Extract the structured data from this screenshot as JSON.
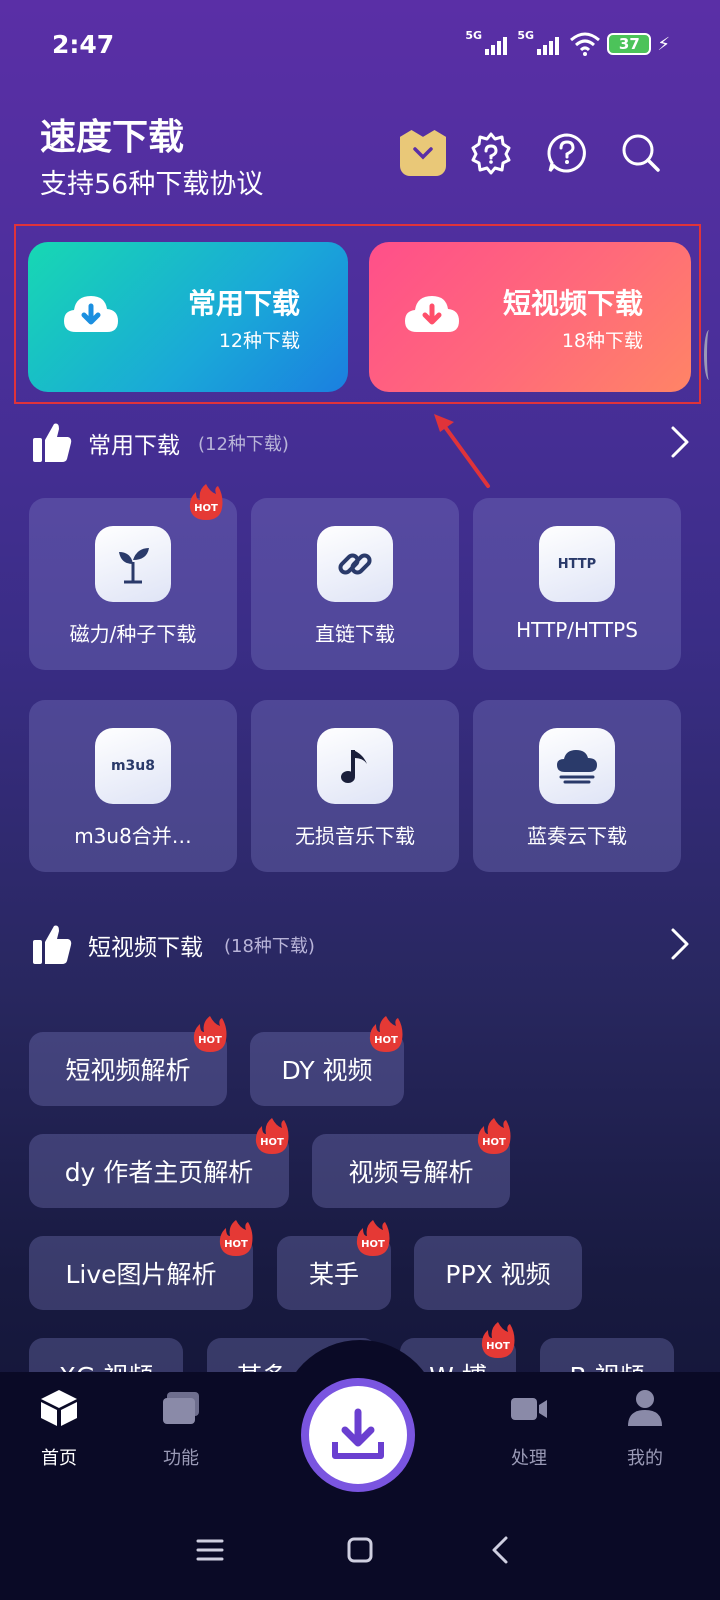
{
  "status": {
    "time": "2:47",
    "net1": "5G",
    "net2": "5G",
    "battery": "37"
  },
  "header": {
    "title": "速度下载",
    "subtitle": "支持56种下载协议"
  },
  "feature_cards": [
    {
      "title": "常用下载",
      "count": "12种下载"
    },
    {
      "title": "短视频下载",
      "count": "18种下载"
    }
  ],
  "sections": {
    "common": {
      "title": "常用下载",
      "count": "(12种下载)"
    },
    "short_video": {
      "title": "短视频下载",
      "count": "(18种下载)"
    }
  },
  "common_tiles": [
    {
      "label": "磁力/种子下载",
      "icon": "sprout-icon",
      "hot": true
    },
    {
      "label": "直链下载",
      "icon": "link-icon",
      "hot": false
    },
    {
      "label": "HTTP/HTTPS",
      "icon": "http-icon",
      "icon_text": "HTTP",
      "hot": false
    },
    {
      "label": "m3u8合并…",
      "icon": "m3u8-icon",
      "icon_text": "m3u8",
      "hot": false
    },
    {
      "label": "无损音乐下载",
      "icon": "music-note-icon",
      "hot": false
    },
    {
      "label": "蓝奏云下载",
      "icon": "cloud-icon",
      "hot": false
    }
  ],
  "hot_label": "HOT",
  "chips": [
    {
      "label": "短视频解析",
      "hot": true
    },
    {
      "label": "DY 视频",
      "hot": true
    },
    {
      "label": "dy 作者主页解析",
      "hot": true
    },
    {
      "label": "视频号解析",
      "hot": true
    },
    {
      "label": "Live图片解析",
      "hot": true
    },
    {
      "label": "某手",
      "hot": true
    },
    {
      "label": "PPX 视频",
      "hot": false
    },
    {
      "label": "XG 视频",
      "hot": false
    },
    {
      "label": "某多",
      "hot": false
    },
    {
      "label": "W 博",
      "hot": true
    },
    {
      "label": "B 视频",
      "hot": false
    }
  ],
  "bottom_nav": [
    {
      "label": "首页",
      "icon": "home-cube-icon",
      "active": true
    },
    {
      "label": "功能",
      "icon": "cards-icon",
      "active": false
    },
    {
      "label": "处理",
      "icon": "video-camera-icon",
      "active": false
    },
    {
      "label": "我的",
      "icon": "person-icon",
      "active": false
    }
  ],
  "colors": {
    "accent": "#7a55e0",
    "card_common": "#17d8b3",
    "card_video": "#ff5f84",
    "hot": "#e53935",
    "annotation": "#e0333a"
  }
}
